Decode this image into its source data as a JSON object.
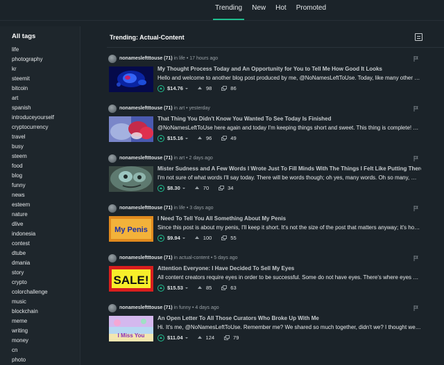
{
  "top_nav": {
    "tabs": [
      {
        "label": "Trending",
        "active": true
      },
      {
        "label": "New",
        "active": false
      },
      {
        "label": "Hot",
        "active": false
      },
      {
        "label": "Promoted",
        "active": false
      }
    ],
    "accent_color": "#1fbf8f"
  },
  "sidebar": {
    "heading": "All tags",
    "tags": [
      "life",
      "photography",
      "kr",
      "steemit",
      "bitcoin",
      "art",
      "spanish",
      "introduceyourself",
      "cryptocurrency",
      "travel",
      "busy",
      "steem",
      "food",
      "blog",
      "funny",
      "news",
      "esteem",
      "nature",
      "dlive",
      "indonesia",
      "contest",
      "dtube",
      "dmania",
      "story",
      "crypto",
      "colorchallenge",
      "music",
      "blockchain",
      "meme",
      "writing",
      "money",
      "cn",
      "photo"
    ]
  },
  "main": {
    "title": "Trending: Actual-Content",
    "view_toggle_icon": "list-view-icon",
    "posts": [
      {
        "author": "nonamesleftttouse (71)",
        "meta": "in life • 17 hours ago",
        "title": "My Thought Process Today and An Opportunity for You to Tell Me How Good It Looks",
        "excerpt": "Hello and welcome to another blog post produced by me, @NoNamesLeftToUse. Today, like many other days, I thought",
        "payout": "$14.76",
        "votes": "98",
        "comments": "86",
        "thumb_label": ""
      },
      {
        "author": "nonamesleftttouse (71)",
        "meta": "in art • yesterday",
        "title": "That Thing You Didn't Know You Wanted To See Today Is Finished",
        "excerpt": "@NoNamesLeftToUse here again and today I'm keeping things short and sweet. This thing is complete! You heard",
        "payout": "$15.16",
        "votes": "96",
        "comments": "49",
        "thumb_label": ""
      },
      {
        "author": "nonamesleftttouse (71)",
        "meta": "in art • 2 days ago",
        "title": "Mister Sudness and A Few Words I Wrote Just To Fill Minds With The Things I Felt Like Putting There",
        "excerpt": "I'm not sure of what words I'll say today. There will be words though; oh yes, many words. Oh so many, many words.",
        "payout": "$8.30",
        "votes": "70",
        "comments": "34",
        "thumb_label": ""
      },
      {
        "author": "nonamesleftttouse (71)",
        "meta": "in life • 3 days ago",
        "title": "I Need To Tell You All Something About My Penis",
        "excerpt": "Since this post is about my penis, I'll keep it short. It's not the size of the post that matters anyway; it's how you",
        "payout": "$9.94",
        "votes": "100",
        "comments": "55",
        "thumb_label": "My Penis"
      },
      {
        "author": "nonamesleftttouse (71)",
        "meta": "in actual-content • 5 days ago",
        "title": "Attention Everyone: I Have Decided To Sell My Eyes",
        "excerpt": "All content creators require eyes in order to be successful.  Some do not have eyes. There's where eyes come in.",
        "payout": "$15.53",
        "votes": "85",
        "comments": "63",
        "thumb_label": "SALE!"
      },
      {
        "author": "nonamesleftttouse (71)",
        "meta": "in funny • 4 days ago",
        "title": "An Open Letter To All Those Curators Who Broke Up With Me",
        "excerpt": "Hi. It's me, @NoNamesLeftToUse.  Remember me?   We shared so much together, didn't we? I thought we did.",
        "payout": "$11.04",
        "votes": "124",
        "comments": "79",
        "thumb_label": "I Miss You"
      }
    ]
  }
}
